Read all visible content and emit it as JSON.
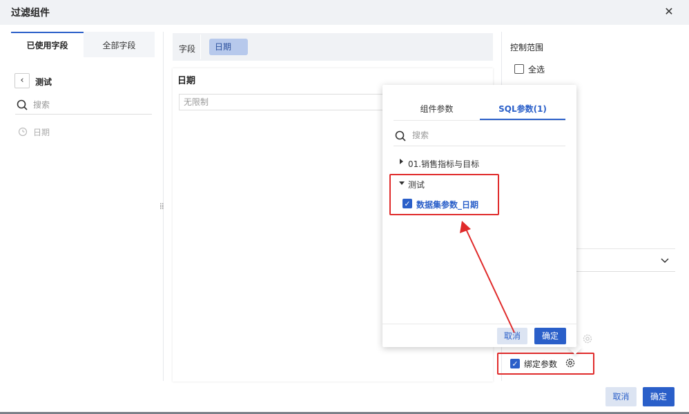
{
  "dialog": {
    "title": "过滤组件"
  },
  "left": {
    "tabs": [
      {
        "label": "已使用字段"
      },
      {
        "label": "全部字段"
      }
    ],
    "folder": "测试",
    "search_placeholder": "搜索",
    "fields": [
      {
        "label": "日期"
      }
    ]
  },
  "middle": {
    "field_label": "字段",
    "field_chip": "日期",
    "widget_title": "日期",
    "widget_placeholder": "无限制"
  },
  "right": {
    "control_range_label": "控制范围",
    "select_all_label": "全选",
    "select_value": "",
    "bind_param_label": "绑定参数",
    "bind_param_checked": true
  },
  "popup": {
    "tabs": [
      {
        "label": "组件参数"
      },
      {
        "label": "SQL参数(1)"
      }
    ],
    "active_tab": 1,
    "search_placeholder": "搜索",
    "tree": [
      {
        "label": "01.销售指标与目标",
        "expanded": false
      },
      {
        "label": "测试",
        "expanded": true,
        "children": [
          {
            "label": "数据集参数_日期",
            "checked": true
          }
        ]
      }
    ],
    "cancel_label": "取消",
    "ok_label": "确定"
  },
  "footer": {
    "cancel_label": "取消",
    "ok_label": "确定"
  },
  "colors": {
    "accent": "#2a5fc9",
    "highlight": "#e02a2a"
  }
}
